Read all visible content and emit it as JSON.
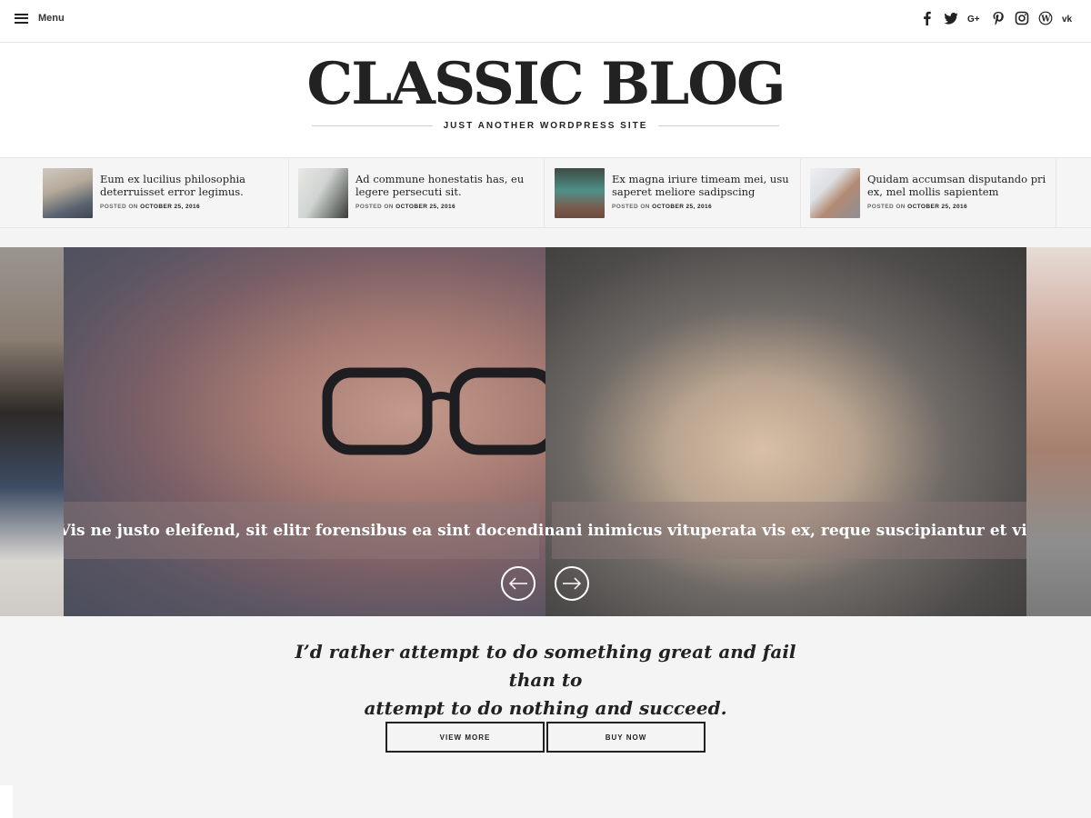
{
  "topbar": {
    "menu_label": "Menu",
    "social_icons": [
      "facebook-icon",
      "twitter-icon",
      "google-plus-icon",
      "pinterest-icon",
      "instagram-icon",
      "wordpress-icon",
      "vk-icon"
    ]
  },
  "header": {
    "site_title": "CLASSIC BLOG",
    "tagline": "JUST ANOTHER WORDPRESS SITE"
  },
  "featured_posts": [
    {
      "title": "Eum ex lucilius philosophia deterruisset error legimus.",
      "meta_prefix": "POSTED ON",
      "date": "OCTOBER 25, 2016"
    },
    {
      "title": "Ad commune honestatis has, eu legere persecuti sit.",
      "meta_prefix": "POSTED ON",
      "date": "OCTOBER 25, 2016"
    },
    {
      "title": "Ex magna iriure timeam mei, usu saperet meliore sadipscing",
      "meta_prefix": "POSTED ON",
      "date": "OCTOBER 25, 2016"
    },
    {
      "title": "Quidam accumsan disputando pri ex, mel mollis sapientem",
      "meta_prefix": "POSTED ON",
      "date": "OCTOBER 25, 2016"
    }
  ],
  "slider": {
    "slides": [
      {
        "caption": "Vis ne justo eleifend, sit elitr forensibus ea sint docendi"
      },
      {
        "caption": "Inani inimicus vituperata vis ex, reque suscipiantur et vix."
      }
    ]
  },
  "quote": {
    "line1": "I’d rather attempt to do something great and fail than to",
    "line2": "attempt to do nothing and succeed."
  },
  "buttons": {
    "view_more": "VIEW MORE",
    "buy_now": "BUY NOW"
  },
  "colors": {
    "background": "#f4f4f4",
    "text": "#222222",
    "white": "#ffffff"
  }
}
